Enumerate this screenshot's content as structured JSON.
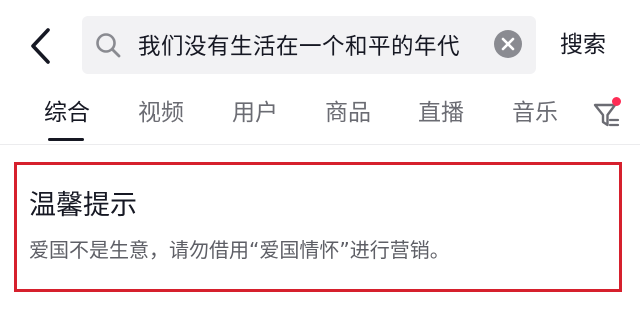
{
  "header": {
    "search_query": "我们没有生活在一个和平的年代",
    "search_button_label": "搜索"
  },
  "tabs": [
    {
      "label": "综合",
      "active": true
    },
    {
      "label": "视频",
      "active": false
    },
    {
      "label": "用户",
      "active": false
    },
    {
      "label": "商品",
      "active": false
    },
    {
      "label": "直播",
      "active": false
    },
    {
      "label": "音乐",
      "active": false
    }
  ],
  "notice": {
    "title": "温馨提示",
    "body": "爱国不是生意，请勿借用“爱国情怀”进行营销。"
  },
  "colors": {
    "accent_red": "#d6202d",
    "notification_dot": "#fe2c55",
    "text_primary": "#161823",
    "text_secondary": "#6b6c73"
  },
  "icons": {
    "back": "chevron-left-icon",
    "search": "search-icon",
    "clear": "clear-icon",
    "filter": "filter-icon"
  }
}
